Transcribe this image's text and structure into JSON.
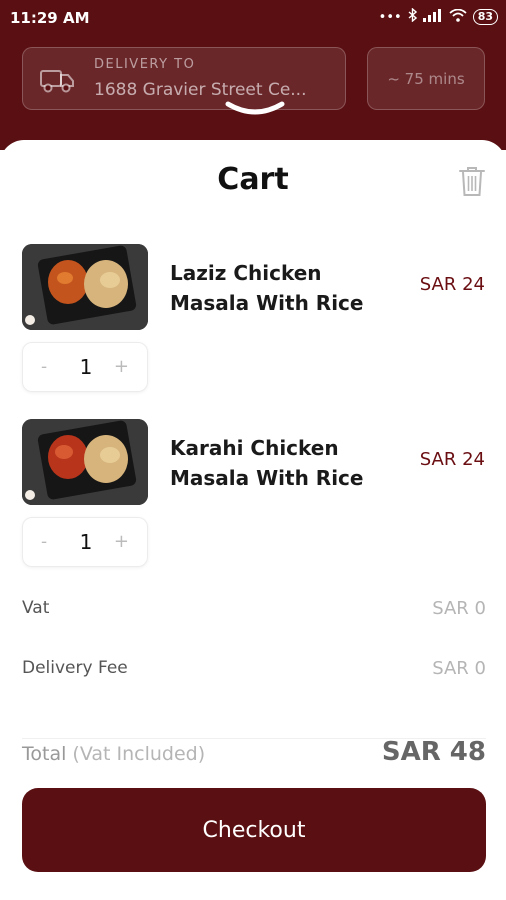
{
  "status_bar": {
    "time": "11:29 AM",
    "battery": "83"
  },
  "header": {
    "delivery_label": "DELIVERY TO",
    "delivery_address": "1688 Gravier Street Ce...",
    "eta": "~ 75 mins"
  },
  "cart": {
    "title": "Cart",
    "items": [
      {
        "name": "Laziz Chicken Masala With Rice",
        "price": "SAR 24",
        "quantity": "1"
      },
      {
        "name": "Karahi Chicken Masala With Rice",
        "price": "SAR 24",
        "quantity": "1"
      }
    ],
    "stepper": {
      "minus": "-",
      "plus": "+"
    }
  },
  "summary": {
    "vat_label": "Vat",
    "vat_value": "SAR 0",
    "delivery_fee_label": "Delivery Fee",
    "delivery_fee_value": "SAR 0",
    "total_label": "Total",
    "total_sub": "(Vat Included)",
    "total_value": "SAR 48"
  },
  "checkout_label": "Checkout",
  "colors": {
    "brand": "#5a0f12",
    "price": "#6a0e12"
  }
}
